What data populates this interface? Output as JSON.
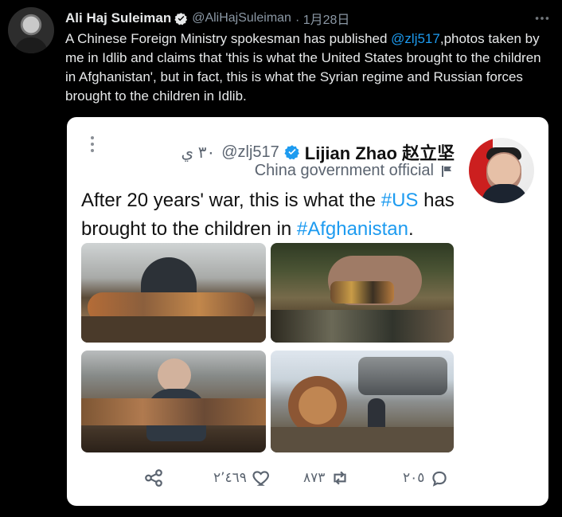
{
  "author": {
    "name": "Ali Haj Suleiman",
    "handle": "@AliHajSuleiman",
    "date": "· 1月28日"
  },
  "tweet": {
    "text_before": "A Chinese Foreign Ministry spokesman has published ",
    "mention": "@zlj517",
    "text_after": ",photos taken by me in Idlib and claims that 'this is what the United States brought to the children in Afghanistan', but in fact, this is what the Syrian regime and Russian forces brought to the children in Idlib."
  },
  "embedded": {
    "arabic_time": "٣٠ ي",
    "handle": "@zlj517",
    "name": "Lijian Zhao 赵立坚",
    "label": "China government official",
    "text_before": "After 20 years' war, this is what the ",
    "hashtag1": "#US",
    "text_middle": " has brought to the children in ",
    "hashtag2": "#Afghanistan",
    "text_end": ".",
    "counts": {
      "likes": "٢٬٤٦٩",
      "retweets": "٨٧٣",
      "replies": "٢٠٥"
    }
  },
  "colors": {
    "background": "#000000",
    "link": "#1d9bf0",
    "card": "#ffffff"
  }
}
